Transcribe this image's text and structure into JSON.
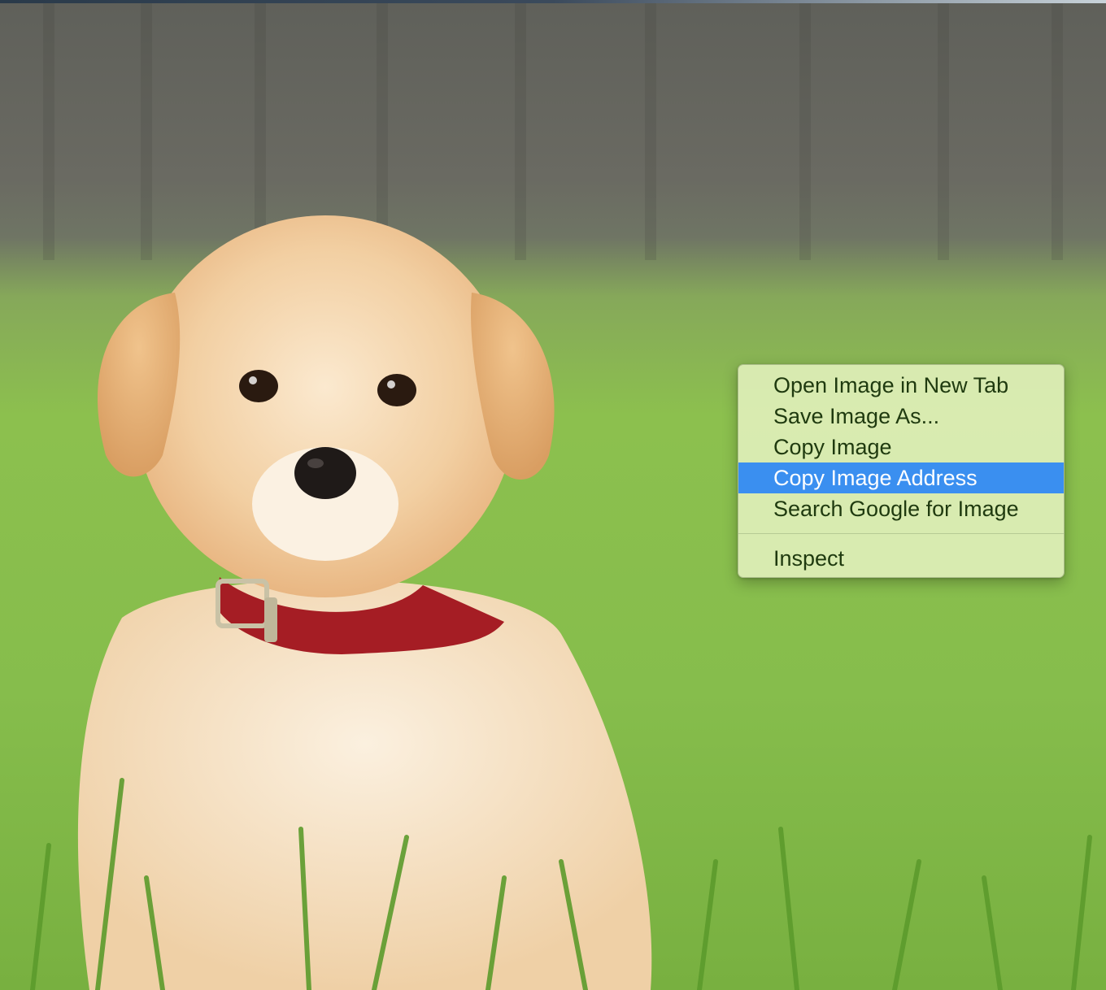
{
  "context_menu": {
    "items": [
      {
        "label": "Open Image in New Tab"
      },
      {
        "label": "Save Image As..."
      },
      {
        "label": "Copy Image"
      },
      {
        "label": "Copy Image Address",
        "highlighted": true
      },
      {
        "label": "Search Google for Image"
      }
    ],
    "secondary_items": [
      {
        "label": "Inspect"
      }
    ],
    "highlight_color": "#3a8ff0",
    "background_color": "#dcecb4"
  }
}
